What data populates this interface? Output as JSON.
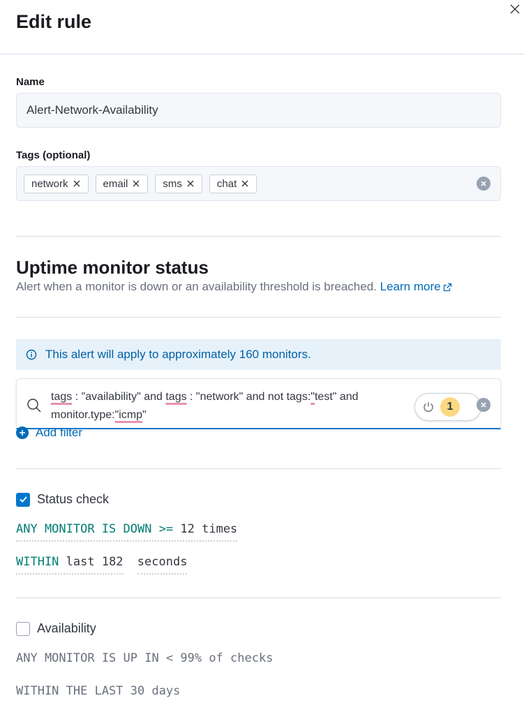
{
  "flyout": {
    "title": "Edit rule"
  },
  "name_field": {
    "label": "Name",
    "value": "Alert-Network-Availability"
  },
  "tags_field": {
    "label": "Tags (optional)",
    "tags": [
      "network",
      "email",
      "sms",
      "chat"
    ]
  },
  "rule_type": {
    "title": "Uptime monitor status",
    "description": "Alert when a monitor is down or an availability threshold is breached.",
    "learn_more": "Learn more"
  },
  "callout": {
    "text": "This alert will apply to approximately 160 monitors."
  },
  "query": {
    "parts": [
      "tags",
      " : \"availability\"  and ",
      "tags",
      " : \"network\" and not tags:",
      "\"",
      "test\" and monitor.type:",
      "\"icmp",
      "\""
    ],
    "filter_count": "1"
  },
  "add_filter": {
    "label": "Add filter"
  },
  "status_check": {
    "label": "Status check",
    "checked": true,
    "row1": {
      "keyword": "ANY MONITOR IS DOWN >=",
      "value": " 12 times"
    },
    "row2": {
      "keyword": "WITHIN",
      "value": " last 182",
      "unit": "seconds"
    }
  },
  "availability": {
    "label": "Availability",
    "checked": false,
    "row1": "ANY MONITOR IS UP IN < 99% of checks",
    "row2": "WITHIN THE LAST 30 days"
  },
  "colors": {
    "primary": "#0077cc",
    "link": "#006bb8",
    "keyword": "#017d73",
    "callout_bg": "#e6f1fa",
    "badge": "#fcd883"
  }
}
